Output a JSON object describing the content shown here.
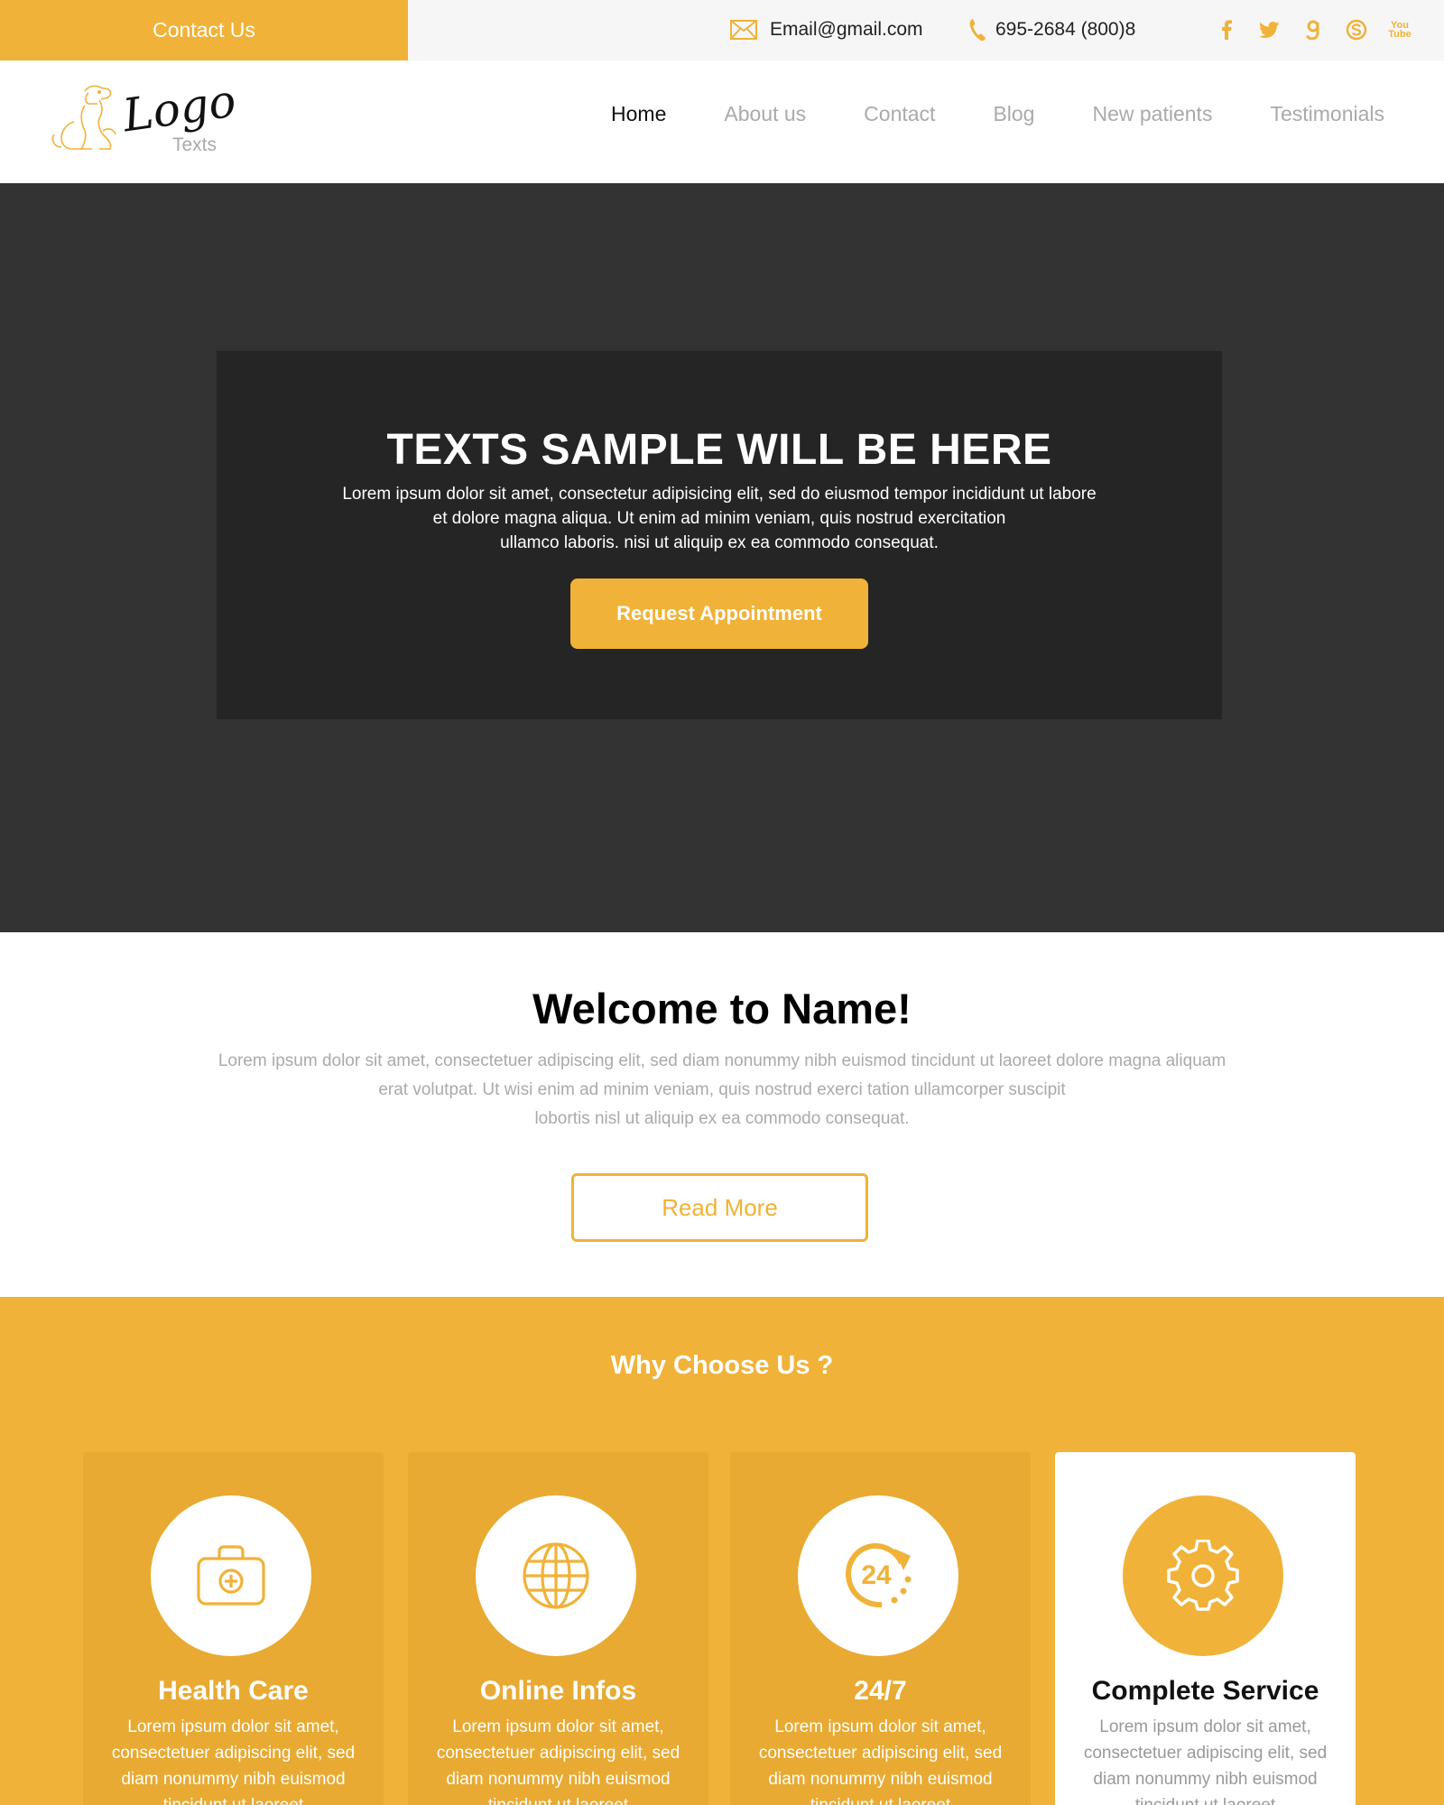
{
  "topbar": {
    "contact_label": "Contact Us",
    "email": "Email@gmail.com",
    "phone": "695-2684 (800)8",
    "socials": [
      "facebook-icon",
      "twitter-icon",
      "google-icon",
      "skype-icon",
      "youtube-icon"
    ],
    "youtube_line1": "You",
    "youtube_line2": "Tube"
  },
  "header": {
    "logo_word": "Logo",
    "logo_sub": "Texts",
    "nav": [
      "Home",
      "About us",
      "Contact",
      "Blog",
      "New patients",
      "Testimonials"
    ],
    "active_nav": "Home"
  },
  "hero": {
    "title": "TEXTS SAMPLE WILL BE HERE",
    "line1": "Lorem ipsum dolor sit amet, consectetur adipisicing elit, sed do eiusmod tempor incididunt ut labore",
    "line2": "et dolore magna aliqua. Ut enim ad minim veniam, quis nostrud exercitation",
    "line3": "ullamco laboris. nisi ut aliquip ex ea commodo consequat.",
    "button": "Request Appointment"
  },
  "welcome": {
    "title": "Welcome to Name!",
    "line1": "Lorem ipsum dolor sit amet, consectetuer adipiscing elit, sed diam nonummy nibh euismod tincidunt ut laoreet dolore magna aliquam",
    "line2": "erat volutpat. Ut wisi enim ad minim veniam, quis nostrud exerci tation ullamcorper suscipit",
    "line3": "lobortis nisl ut aliquip ex ea commodo consequat.",
    "button": "Read More"
  },
  "why": {
    "title": "Why Choose Us ?",
    "cards": [
      {
        "title": "Health Care",
        "icon": "medical-kit-icon",
        "text": "Lorem ipsum dolor sit amet, consectetuer adipiscing elit, sed diam nonummy nibh euismod tincidunt ut laoreet"
      },
      {
        "title": "Online Infos",
        "icon": "globe-icon",
        "text": "Lorem ipsum dolor sit amet, consectetuer adipiscing elit, sed diam nonummy nibh euismod tincidunt ut laoreet"
      },
      {
        "title": "24/7",
        "icon": "24-hours-icon",
        "text": "Lorem ipsum dolor sit amet, consectetuer adipiscing elit, sed diam nonummy nibh euismod tincidunt ut laoreet"
      },
      {
        "title": "Complete Service",
        "icon": "gear-icon",
        "text": "Lorem ipsum dolor sit amet, consectetuer adipiscing elit, sed diam nonummy nibh euismod tincidunt ut laoreet"
      }
    ],
    "icon_24_label": "24"
  },
  "colors": {
    "accent": "#f0b238",
    "hero_bg": "#333333",
    "hero_box": "#252525"
  }
}
